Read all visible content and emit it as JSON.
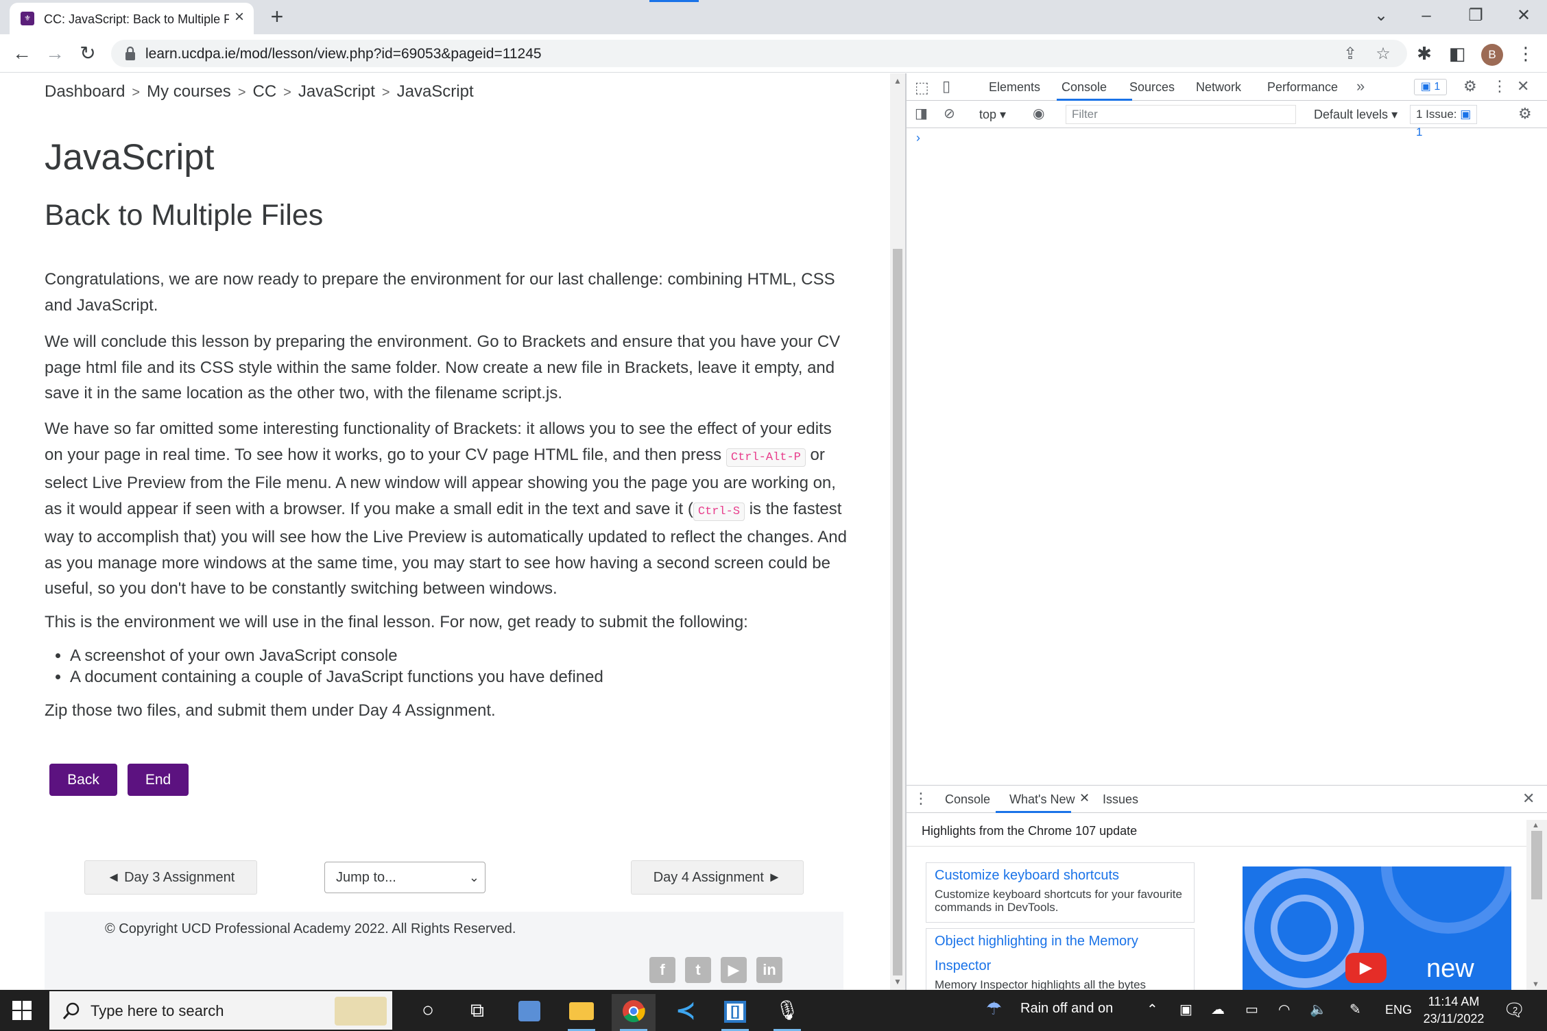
{
  "browser": {
    "tab_title": "CC: JavaScript: Back to Multiple F",
    "favicon_letter": "UCD",
    "url": "learn.ucdpa.ie/mod/lesson/view.php?id=69053&pageid=11245",
    "profile_initial": "B"
  },
  "breadcrumb": [
    "Dashboard",
    "My courses",
    "CC",
    "JavaScript",
    "JavaScript"
  ],
  "course_title": "JavaScript",
  "lesson_title": "Back to Multiple Files",
  "content": {
    "p1": "Congratulations, we are now ready to prepare the environment for our last challenge: combining HTML, CSS and JavaScript.",
    "p2": "We will conclude this lesson by preparing the environment. Go to Brackets and ensure that you have your CV page html file and its CSS style within the same folder. Now create a new file in Brackets, leave it empty, and save it in the same location as the other two, with the filename script.js.",
    "p3_a": "We have so far omitted some interesting functionality of Brackets: it allows you to see the effect of your edits on your page in real time. To see how it works, go to your CV page HTML file, and then press ",
    "p3_kbd1": "Ctrl-Alt-P",
    "p3_b": " or select Live Preview from the File menu. A new window will appear showing you the page you are working on, as it would appear if seen with a browser. If you make a small edit in the text and save it (",
    "p3_kbd2": "Ctrl-S",
    "p3_c": " is the fastest way to accomplish that) you will see how the Live Preview is automatically updated to reflect the changes. And as you manage more windows at the same time, you may start to see how having a second screen could be useful, so you don't have to be constantly switching between windows.",
    "p4": "This is the environment we will use in the final lesson. For now, get ready to submit the following:",
    "bullets": [
      "A screenshot of your own JavaScript console",
      "A document containing a couple of JavaScript functions you have defined"
    ],
    "p5": "Zip those two files, and submit them under Day 4 Assignment."
  },
  "buttons": {
    "back": "Back",
    "end": "End"
  },
  "activity_nav": {
    "prev": "◄ Day 3 Assignment",
    "jump_placeholder": "Jump to...",
    "next": "Day 4 Assignment ►"
  },
  "footer": {
    "copyright": "© Copyright UCD Professional Academy 2022. All Rights Reserved."
  },
  "devtools": {
    "tabs": [
      "Elements",
      "Console",
      "Sources",
      "Network",
      "Performance"
    ],
    "active_tab": "Console",
    "issues_badge": "1",
    "context": "top",
    "filter_placeholder": "Filter",
    "levels": "Default levels",
    "issues_label": "1 Issue:",
    "issues_count": "1",
    "drawer_tabs": [
      "Console",
      "What's New",
      "Issues"
    ],
    "drawer_active": "What's New",
    "highlights": "Highlights from the Chrome 107 update",
    "cards": [
      {
        "title": "Customize keyboard shortcuts",
        "desc": "Customize keyboard shortcuts for your favourite commands in DevTools."
      },
      {
        "title": "Object highlighting in the Memory Inspector",
        "desc": "Memory Inspector highlights all the bytes"
      }
    ],
    "video_word": "new"
  },
  "taskbar": {
    "search_placeholder": "Type here to search",
    "weather": "Rain off and on",
    "language": "ENG",
    "time": "11:14 AM",
    "date": "23/11/2022",
    "notifications": "2"
  }
}
